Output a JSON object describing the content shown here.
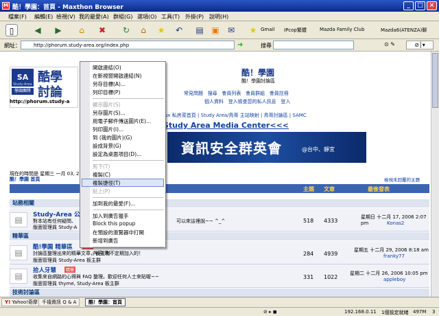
{
  "window": {
    "title": "酷！學園：首頁 - Maxthon Browser",
    "controls": [
      "_",
      "□",
      "×"
    ]
  },
  "menu": [
    "檔案(F)",
    "編輯(E)",
    "檢視(V)",
    "我的最愛(A)",
    "群組(G)",
    "選項(O)",
    "工具(T)",
    "外掛(P)",
    "說明(H)"
  ],
  "favorites": [
    "Gmail",
    "IPcop繁體",
    "Mazda Family Club",
    "Mazda6(ATENZA)聊"
  ],
  "address": {
    "label": "網址：",
    "url": "http://phorum.study-area.org/index.php",
    "search_label": "搜尋"
  },
  "site": {
    "logo_top": "酷學",
    "logo_bottom": "討論",
    "logo_tag": "學園團隊",
    "logo_sub": "Study-Area",
    "url_fragment": "http://phorum.study-a",
    "title": "酷！學園",
    "subtitle": "酷！學園討論區",
    "nav1": [
      "常見問題",
      "搜尋",
      "會員列表",
      "會員群組",
      "會員註冊"
    ],
    "nav2": [
      "個人資料",
      "登入檢查您的私人訊息",
      "登入"
    ],
    "links": [
      "ux 私房菜首頁",
      "Study Area/鳥哥 主站映射",
      "鳥哥討論區",
      "SAMC"
    ],
    "media": "Study Area Media Center<<<",
    "banner": "資訊安全群英會",
    "banner_sub": "@台中、靜宜"
  },
  "forum": {
    "time": "現在的時間是 星期三 一月 03, 2",
    "home": "酷！學園 首頁",
    "unanswered": "檢視未回覆的主題",
    "col_topics": "主題",
    "col_posts": "文章",
    "col_last": "最後發表",
    "sections": [
      {
        "name": "站務相關",
        "rows": [
          {
            "title": "Study-Area 公開",
            "desc": "對本站有任何疑問、",
            "desc2": "可以來這裡說~~ ^_^",
            "mods": "版面管理員 Study-A",
            "topics": "518",
            "posts": "4333",
            "date": "星期日 十二月 17, 2006 2:07 pm",
            "user": "Konas2"
          }
        ]
      },
      {
        "name": "精華區",
        "rows": [
          {
            "title": "酷!學園 精華區",
            "badge": "精華",
            "desc": "討論區整理出來的精華文章，板主會不定期加入的！",
            "mods": "版面管理員 Study-Area 板主群",
            "topics": "284",
            "posts": "4939",
            "date": "星期五 十二月 29, 2006 8:18 am",
            "user": "franky77"
          },
          {
            "title": "拾人牙慧",
            "badge": "精華",
            "desc": "收集來自網路的心得與 FAQ 整理。歡迎任何人士來貼喔~~",
            "mods": "版面管理員 thyme, Study-Area 板主群",
            "topics": "331",
            "posts": "1022",
            "date": "星期二 十二月 26, 2006 10:05 pm",
            "user": "appleboy"
          }
        ]
      },
      {
        "name": "技術討論區",
        "rows": []
      }
    ]
  },
  "context_menu": [
    {
      "label": "開啟連結(O)",
      "disabled": false
    },
    {
      "label": "在新視窗開啟連結(N)",
      "disabled": false
    },
    {
      "label": "另存目標(A)...",
      "disabled": false
    },
    {
      "label": "列印目標(P)",
      "disabled": false
    },
    {
      "sep": true
    },
    {
      "label": "顯示圖片(S)",
      "disabled": true
    },
    {
      "label": "另存圖片(S)...",
      "disabled": false
    },
    {
      "label": "用電子郵件傳送圖片(E)...",
      "disabled": false
    },
    {
      "label": "列印圖片(I)...",
      "disabled": false
    },
    {
      "label": "到 (我的圖片)(G)",
      "disabled": false
    },
    {
      "label": "設成背景(G)",
      "disabled": false
    },
    {
      "label": "設定為桌面項目(D)...",
      "disabled": false
    },
    {
      "sep": true
    },
    {
      "label": "剪下(T)",
      "disabled": true
    },
    {
      "label": "複製(C)",
      "disabled": false
    },
    {
      "label": "複製捷徑(T)",
      "disabled": false,
      "highlight": true
    },
    {
      "label": "貼上(P)",
      "disabled": true
    },
    {
      "sep": true
    },
    {
      "label": "加到我的最愛(F)...",
      "disabled": false
    },
    {
      "sep": true
    },
    {
      "label": "加入到廣告獵手",
      "disabled": false
    },
    {
      "label": "Block this popup",
      "disabled": false
    },
    {
      "label": "在預設的瀏覽器中打開",
      "disabled": false
    },
    {
      "label": "新增到廣告",
      "disabled": false
    },
    {
      "sep": true
    },
    {
      "label": "內容(R)",
      "disabled": false
    }
  ],
  "tabs": [
    "Yahoo!奇摩",
    "千禧資訊 Q & A",
    "酷！學園：首頁"
  ],
  "status": {
    "ip": "192.168.0.11",
    "mode": "1個設定就緒",
    "mem": "497M",
    "num": "3"
  },
  "colors": {
    "title": "#0a2a8a",
    "section": "#dde3ef",
    "highlight": "#dde6f6",
    "link": "#1040a0"
  }
}
